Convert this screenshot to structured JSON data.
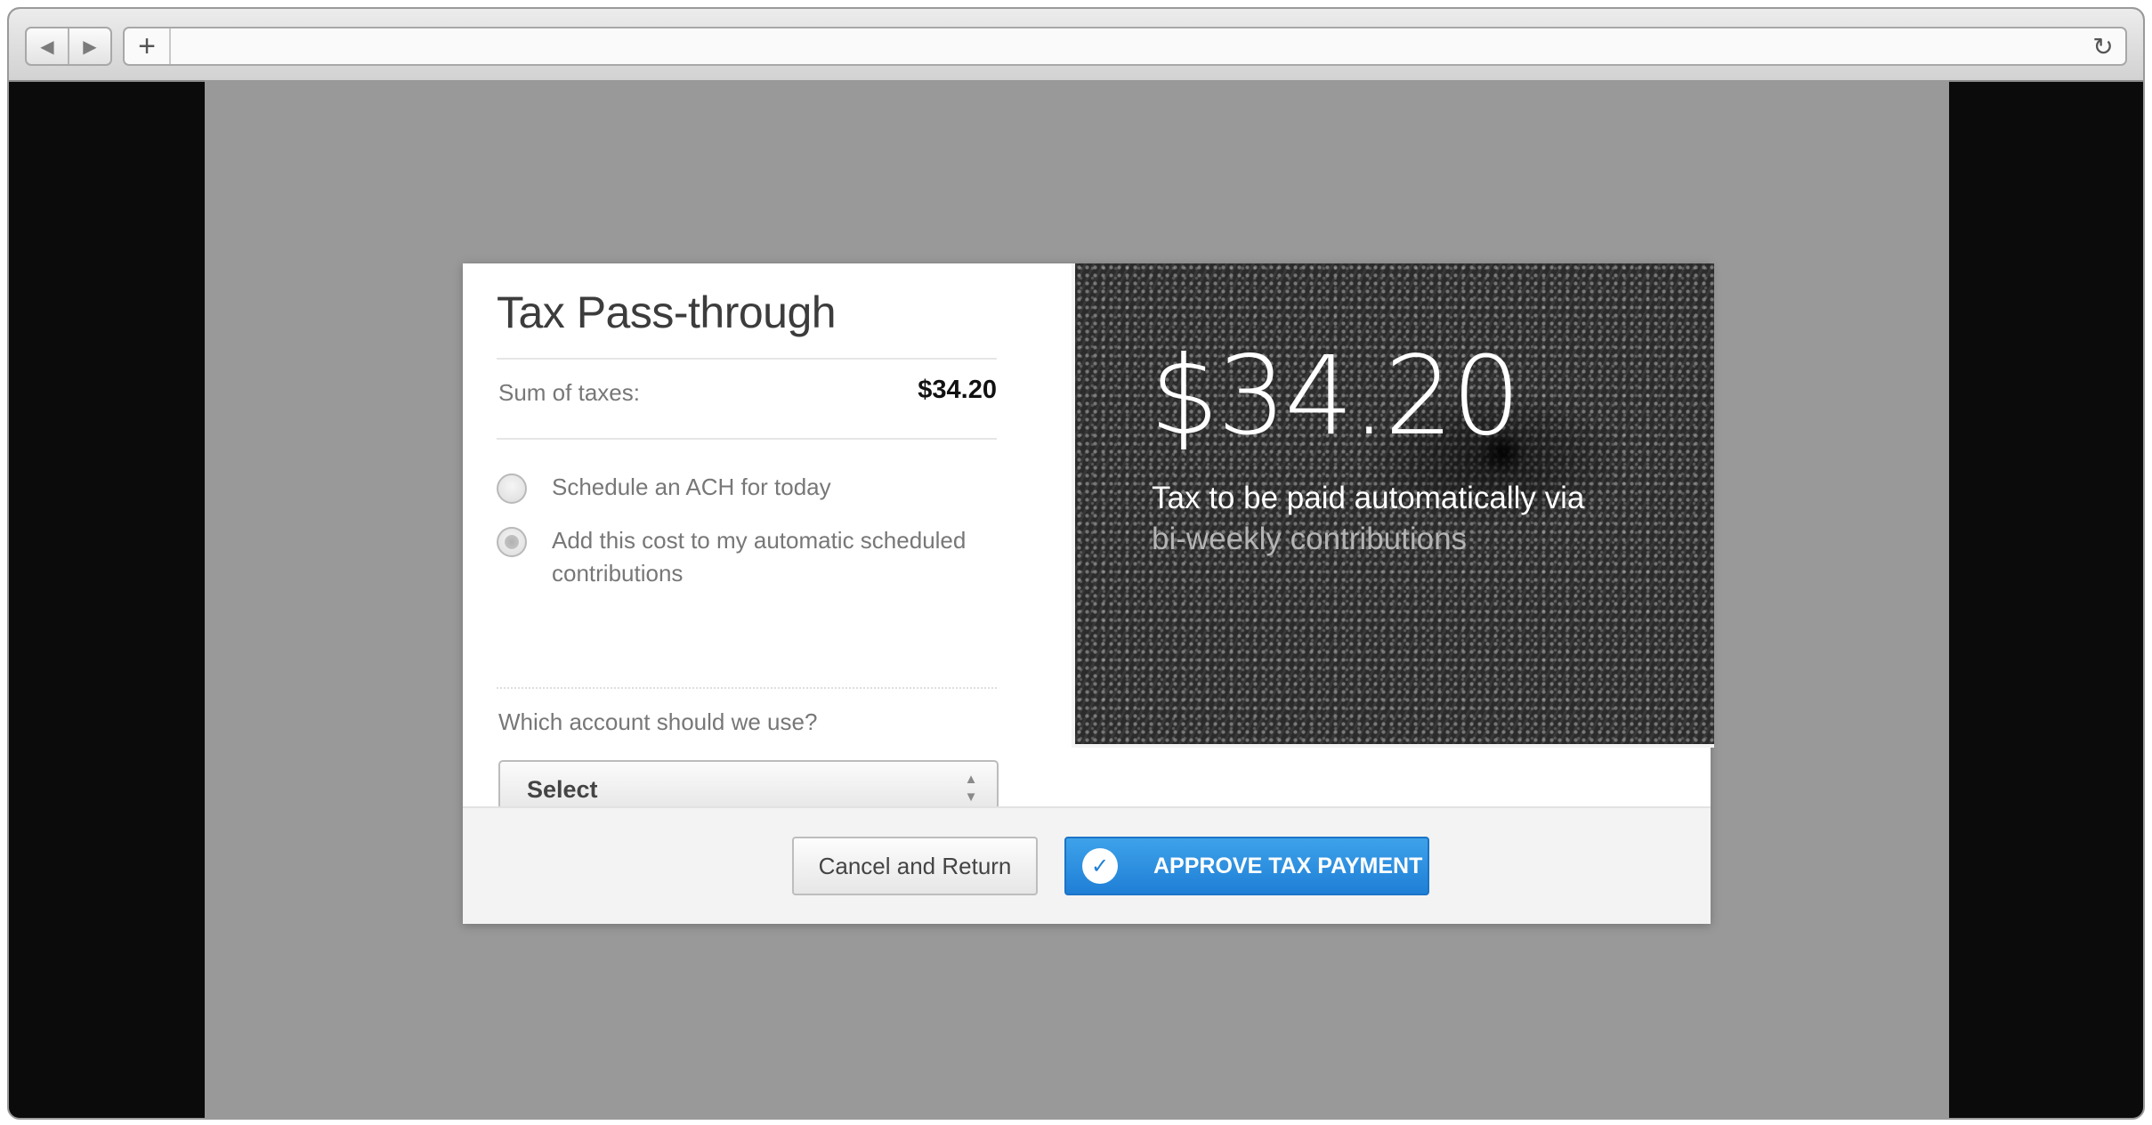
{
  "browser": {
    "back_icon": "◀",
    "forward_icon": "▶",
    "new_tab_icon": "+",
    "reload_icon": "↻",
    "url": ""
  },
  "modal": {
    "title": "Tax Pass-through",
    "sum_label": "Sum of taxes:",
    "sum_value": "$34.20",
    "options": [
      {
        "label": "Schedule an ACH for today",
        "selected": false
      },
      {
        "label": "Add this cost to my automatic scheduled contributions",
        "selected": false
      }
    ],
    "account_question": "Which account should we use?",
    "account_select": {
      "value": "Select"
    }
  },
  "hero": {
    "amount": "$34.20",
    "line1": "Tax to be paid automatically via",
    "line2": "bi-weekly contributions"
  },
  "footer": {
    "cancel_label": "Cancel and Return",
    "approve_label": "APPROVE TAX PAYMENT",
    "approve_icon": "✓"
  },
  "colors": {
    "accent": "#2a8de0",
    "overlay": "#999999"
  }
}
